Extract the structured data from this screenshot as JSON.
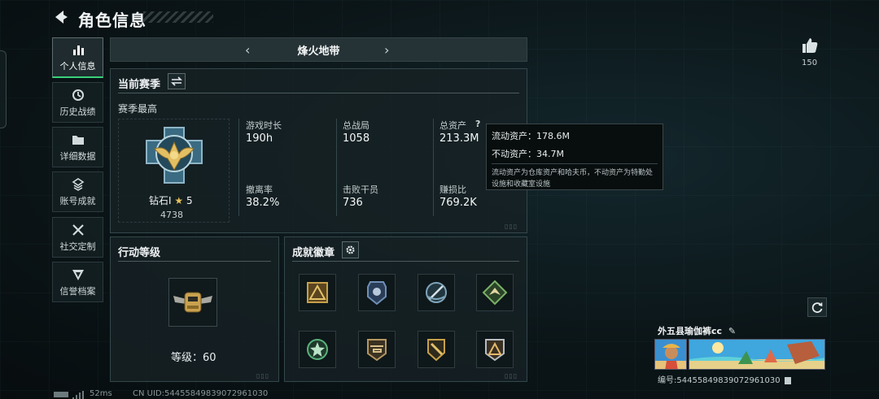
{
  "header": {
    "title": "角色信息"
  },
  "sidebar": {
    "items": [
      {
        "label": "个人信息",
        "icon": "bar-chart-icon",
        "active": true
      },
      {
        "label": "历史战绩",
        "icon": "history-icon",
        "active": false
      },
      {
        "label": "详细数据",
        "icon": "folder-icon",
        "active": false
      },
      {
        "label": "账号成就",
        "icon": "achievement-icon",
        "active": false
      },
      {
        "label": "社交定制",
        "icon": "tools-icon",
        "active": false
      },
      {
        "label": "信誉档案",
        "icon": "credit-shield-icon",
        "active": false
      }
    ]
  },
  "season_bar": {
    "name": "烽火地带",
    "prev": "‹",
    "next": "›"
  },
  "current_season": {
    "title": "当前赛季",
    "subtitle": "赛季最高",
    "rank_name": "钻石Ⅰ",
    "rank_stars": "5",
    "rank_score": "4738",
    "stats": [
      {
        "label": "游戏时长",
        "value": "190h"
      },
      {
        "label": "总战局",
        "value": "1058"
      },
      {
        "label": "总资产",
        "value": "213.3M",
        "help": "?"
      },
      {
        "label": "撤离率",
        "value": "38.2%"
      },
      {
        "label": "击败干员",
        "value": "736"
      },
      {
        "label": "赚损比",
        "value": "769.2K"
      }
    ]
  },
  "tooltip": {
    "liquid": "流动资产：178.6M",
    "fixed": "不动资产：34.7M",
    "note": "流动资产为仓库资产和哈夫币，不动资产为特勤处设施和收藏室设施"
  },
  "action_level": {
    "title": "行动等级",
    "level_text": "等级：60"
  },
  "badges": {
    "title": "成就徽章",
    "items": [
      {
        "icon": "pyramid-badge-icon",
        "color": "#c7a049"
      },
      {
        "icon": "police-badge-icon",
        "color": "#6f8fb7"
      },
      {
        "icon": "shield-sword-badge-icon",
        "color": "#7ea4b9"
      },
      {
        "icon": "green-wings-badge-icon",
        "color": "#7bb067"
      },
      {
        "icon": "star-badge-icon",
        "color": "#59b27b"
      },
      {
        "icon": "helicopter-badge-icon",
        "color": "#b59660"
      },
      {
        "icon": "knife-badge-icon",
        "color": "#c7a049"
      },
      {
        "icon": "triangle-badge-icon",
        "color": "#b7bcc0"
      }
    ]
  },
  "like": {
    "count": "150"
  },
  "player": {
    "name": "外五县瑜伽裤cc",
    "id": "编号:54455849839072961030"
  },
  "footer": {
    "ping": "52ms",
    "uid": "CN UID:54455849839072961030"
  },
  "colors": {
    "accent": "#3ad17b",
    "gold": "#e7c25a"
  }
}
